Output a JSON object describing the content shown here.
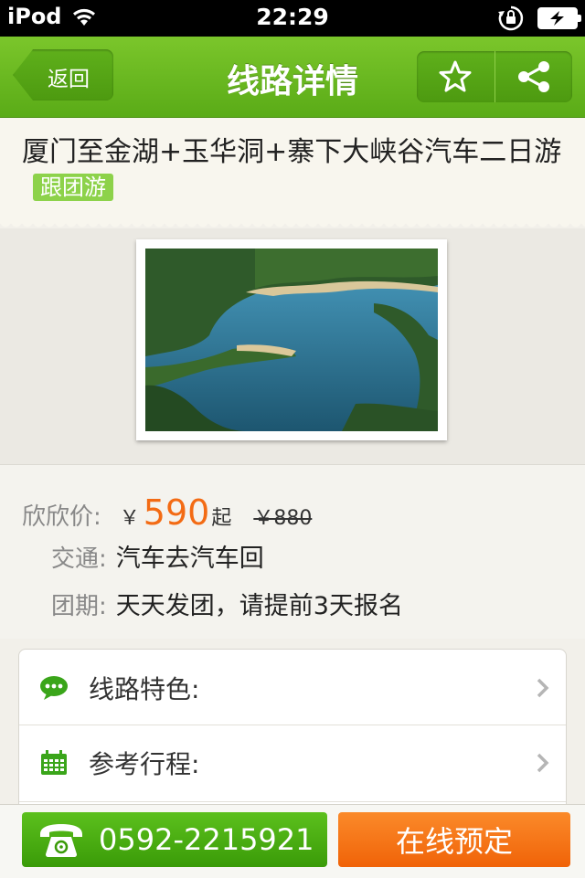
{
  "status_bar": {
    "carrier": "iPod",
    "time": "22:29"
  },
  "nav": {
    "back_label": "返回",
    "title": "线路详情"
  },
  "route": {
    "title": "厦门至金湖+玉华洞+寨下大峡谷汽车二日游",
    "tag": "跟团游"
  },
  "price_row": {
    "label": "欣欣价:",
    "currency": "￥",
    "price": "590",
    "suffix": "起",
    "original_price": "￥880"
  },
  "transport": {
    "label": "交通:",
    "value": "汽车去汽车回"
  },
  "schedule": {
    "label": "团期:",
    "value": "天天发团，请提前3天报名"
  },
  "menu": {
    "items": [
      {
        "label": "线路特色:",
        "icon": "chat-bubble-icon"
      },
      {
        "label": "参考行程:",
        "icon": "calendar-icon"
      }
    ]
  },
  "bottom": {
    "phone": "0592-2215921",
    "book_label": "在线预定"
  },
  "colors": {
    "accent_green": "#5aab17",
    "price_orange": "#f36b14",
    "book_orange": "#f06308"
  }
}
